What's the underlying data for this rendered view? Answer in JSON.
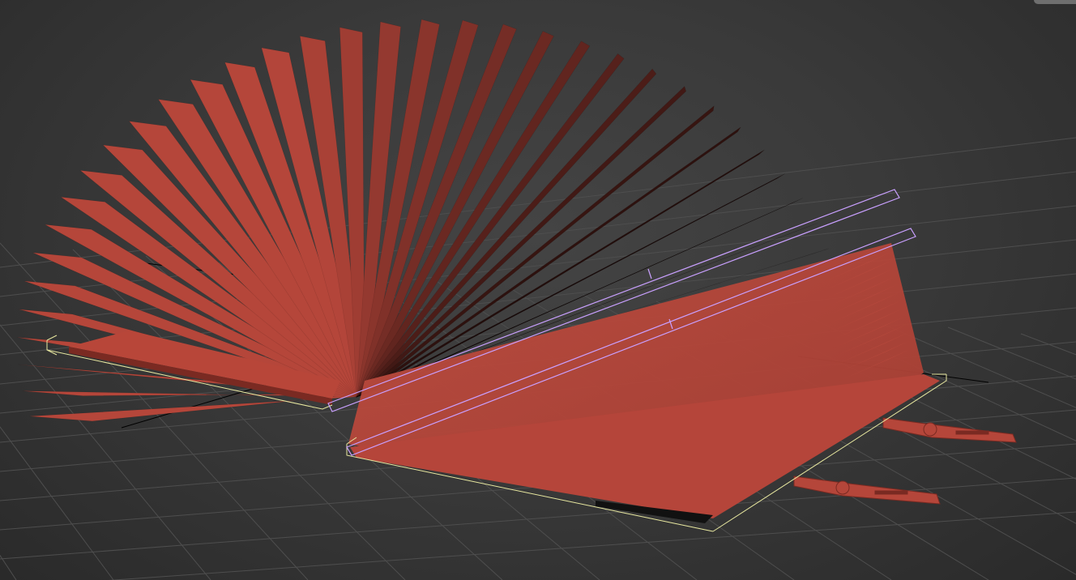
{
  "viewport": {
    "background_color": "#3a3a3a",
    "grid_color": "#4e4e4e",
    "axis_color": "#000000"
  },
  "scene": {
    "object": "open-book",
    "page_color": "#b5463a",
    "page_dark_color": "#1a0806",
    "selection_box_color": "#e8e8a0",
    "spine_gizmo_color": "#c9a0ff"
  }
}
